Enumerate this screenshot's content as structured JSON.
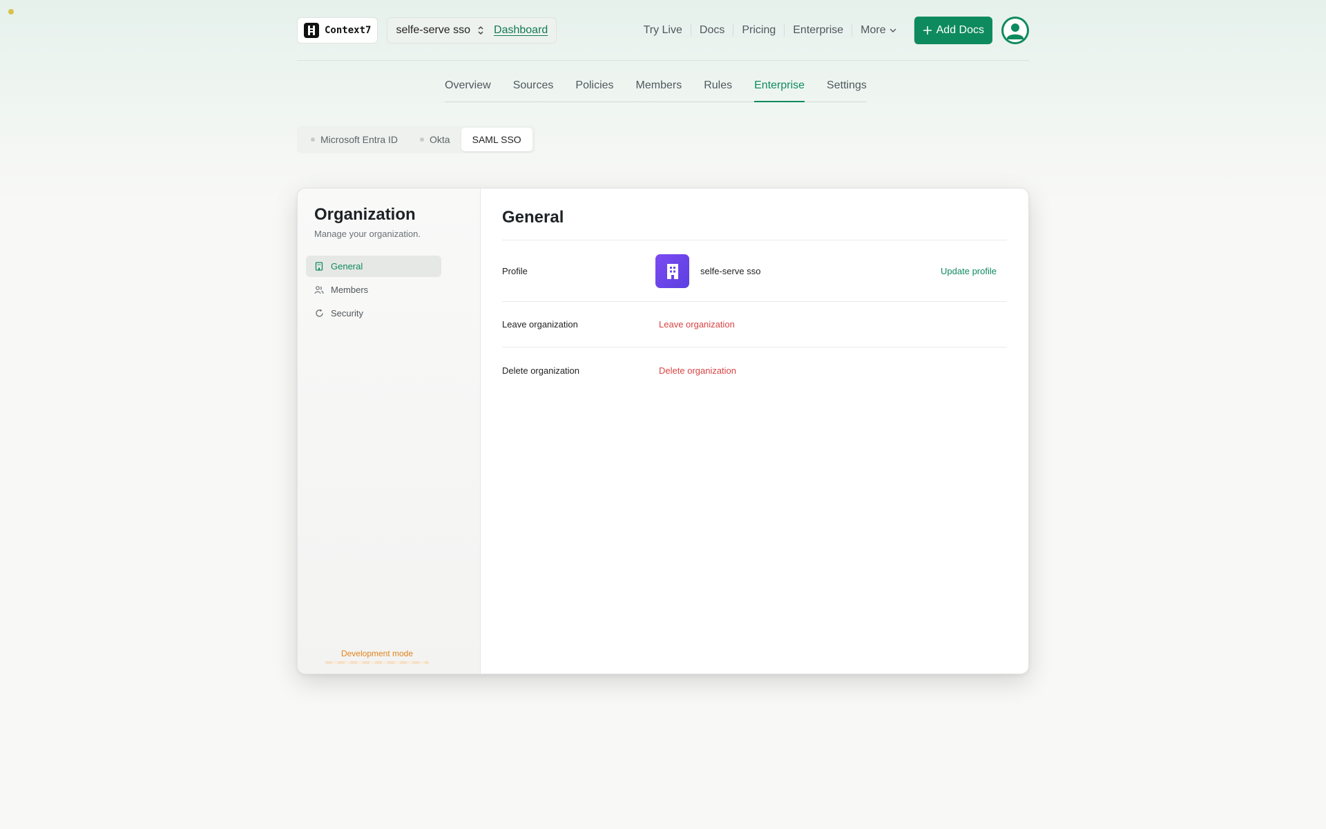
{
  "header": {
    "logo_text": "Context7",
    "org_name": "selfe-serve sso",
    "dashboard_link": "Dashboard",
    "nav": [
      "Try Live",
      "Docs",
      "Pricing",
      "Enterprise"
    ],
    "more_label": "More",
    "add_docs_label": "Add Docs"
  },
  "tabs": [
    {
      "label": "Overview"
    },
    {
      "label": "Sources"
    },
    {
      "label": "Policies"
    },
    {
      "label": "Members"
    },
    {
      "label": "Rules"
    },
    {
      "label": "Enterprise",
      "active": true
    },
    {
      "label": "Settings"
    }
  ],
  "subtabs": [
    {
      "label": "Microsoft Entra ID"
    },
    {
      "label": "Okta"
    },
    {
      "label": "SAML SSO",
      "active": true
    }
  ],
  "sidebar": {
    "title": "Organization",
    "subtitle": "Manage your organization.",
    "items": [
      {
        "label": "General",
        "icon": "building-icon",
        "active": true
      },
      {
        "label": "Members",
        "icon": "users-icon"
      },
      {
        "label": "Security",
        "icon": "shield-icon"
      }
    ],
    "dev_mode": "Development mode"
  },
  "main": {
    "title": "General",
    "profile_label": "Profile",
    "profile_name": "selfe-serve sso",
    "update_profile": "Update profile",
    "leave_label": "Leave organization",
    "leave_action": "Leave organization",
    "delete_label": "Delete organization",
    "delete_action": "Delete organization"
  },
  "colors": {
    "accent": "#0e8a5f",
    "danger": "#d94343",
    "org_logo": "#6a45ea",
    "dev_mode": "#e0821a"
  }
}
